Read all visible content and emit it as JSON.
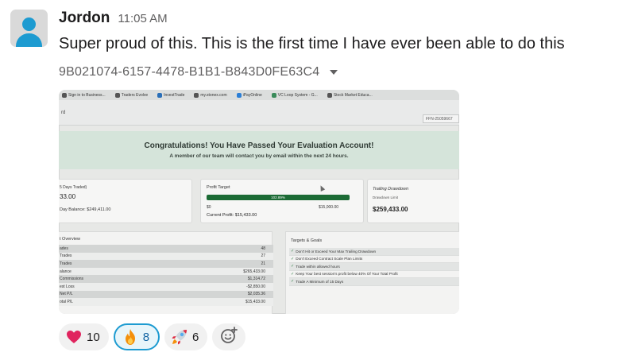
{
  "message": {
    "author": "Jordon",
    "time": "11:05 AM",
    "text": "Super proud of this. This is the first time I have ever been able to do this",
    "attachment_name": "9B021074-6157-4478-B1B1-B843D0FE63C4"
  },
  "photo": {
    "bookmarks": [
      "Sign in to Business...",
      "Traders Evolve",
      "InvestTrade",
      "my.stonex.com",
      "iPayOnline",
      "VC Loop System - G...",
      "Stock Market Educa..."
    ],
    "appbar_left": "rd",
    "account_id": "FFN-25059667",
    "banner_title": "Congratulations! You Have Passed Your Evaluation Account!",
    "banner_subtitle": "A member of our team will contact you by email within the next 24 hours.",
    "days_traded_label": "5 Days Traded)",
    "days_traded_value": "33.00",
    "day_balance": "Day Balance: $249,411.00",
    "profit_target_label": "Profit Target",
    "profit_pct": "102.89%",
    "profit_progress": 1.0,
    "profit_min": "$0",
    "profit_max": "$15,000.00",
    "current_profit": "Current Profit: $15,433.00",
    "drawdown_label": "Trailing Drawdown",
    "drawdown_sub": "Drawdown Limit",
    "drawdown_value": "$259,433.00",
    "overview_title": "t Overview",
    "overview_rows": [
      {
        "label": "ades",
        "value": "48"
      },
      {
        "label": "Trades",
        "value": "27"
      },
      {
        "label": "Trades",
        "value": "21"
      },
      {
        "label": "alance",
        "value": "$265,433.00"
      },
      {
        "label": "Commissions",
        "value": "$1,314.72"
      },
      {
        "label": "est Loss",
        "value": "-$2,850.00"
      },
      {
        "label": "Net P/L",
        "value": "$2,035.36"
      },
      {
        "label": "otal P/L",
        "value": "$15,433.00"
      }
    ],
    "goals_title": "Targets & Goals",
    "goals": [
      "Don't Hit or Exceed Your Max Trailing Drawdown",
      "Don't Exceed Contract Scale Plan Limits",
      "Trade within allowed hours",
      "Keep Your best session's profit below 40% Of Your Total Profit",
      "Trade A Minimum of 15 Days"
    ]
  },
  "reactions": [
    {
      "emoji": "heart",
      "count": "10"
    },
    {
      "emoji": "fire",
      "count": "8"
    },
    {
      "emoji": "rocket",
      "count": "6"
    }
  ]
}
